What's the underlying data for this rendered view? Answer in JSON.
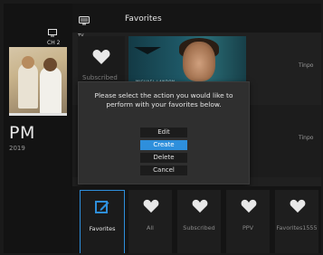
{
  "header": {
    "title": "Favorites",
    "guide_icon": "tv-guide-icon",
    "tv_label": "TV"
  },
  "channel": {
    "icon": "tv-monitor-icon",
    "label": "CH 2"
  },
  "now_playing": {
    "time": "PM",
    "year": "2019",
    "progress": 1.0
  },
  "rows": {
    "subscribed_label": "Subscribed",
    "poster_caption": "MICHAEL LANDON",
    "tinpo_1": "Tinpo",
    "tinpo_2": "Tinpo"
  },
  "dialog": {
    "message": "Please select the action you would like to perform with your favorites below.",
    "options": [
      {
        "label": "Edit",
        "selected": false
      },
      {
        "label": "Create",
        "selected": true
      },
      {
        "label": "Delete",
        "selected": false
      },
      {
        "label": "Cancel",
        "selected": false
      }
    ]
  },
  "categories": [
    {
      "label": "Favorites",
      "icon": "edit-icon",
      "active": true
    },
    {
      "label": "All",
      "icon": "heart-icon",
      "active": false
    },
    {
      "label": "Subscribed",
      "icon": "heart-icon",
      "active": false
    },
    {
      "label": "PPV",
      "icon": "heart-icon",
      "active": false
    },
    {
      "label": "Favorites1555",
      "icon": "heart-icon",
      "active": false
    }
  ],
  "colors": {
    "accent": "#2e8fdc",
    "background": "#141414",
    "dialog": "#2f2f2f"
  }
}
